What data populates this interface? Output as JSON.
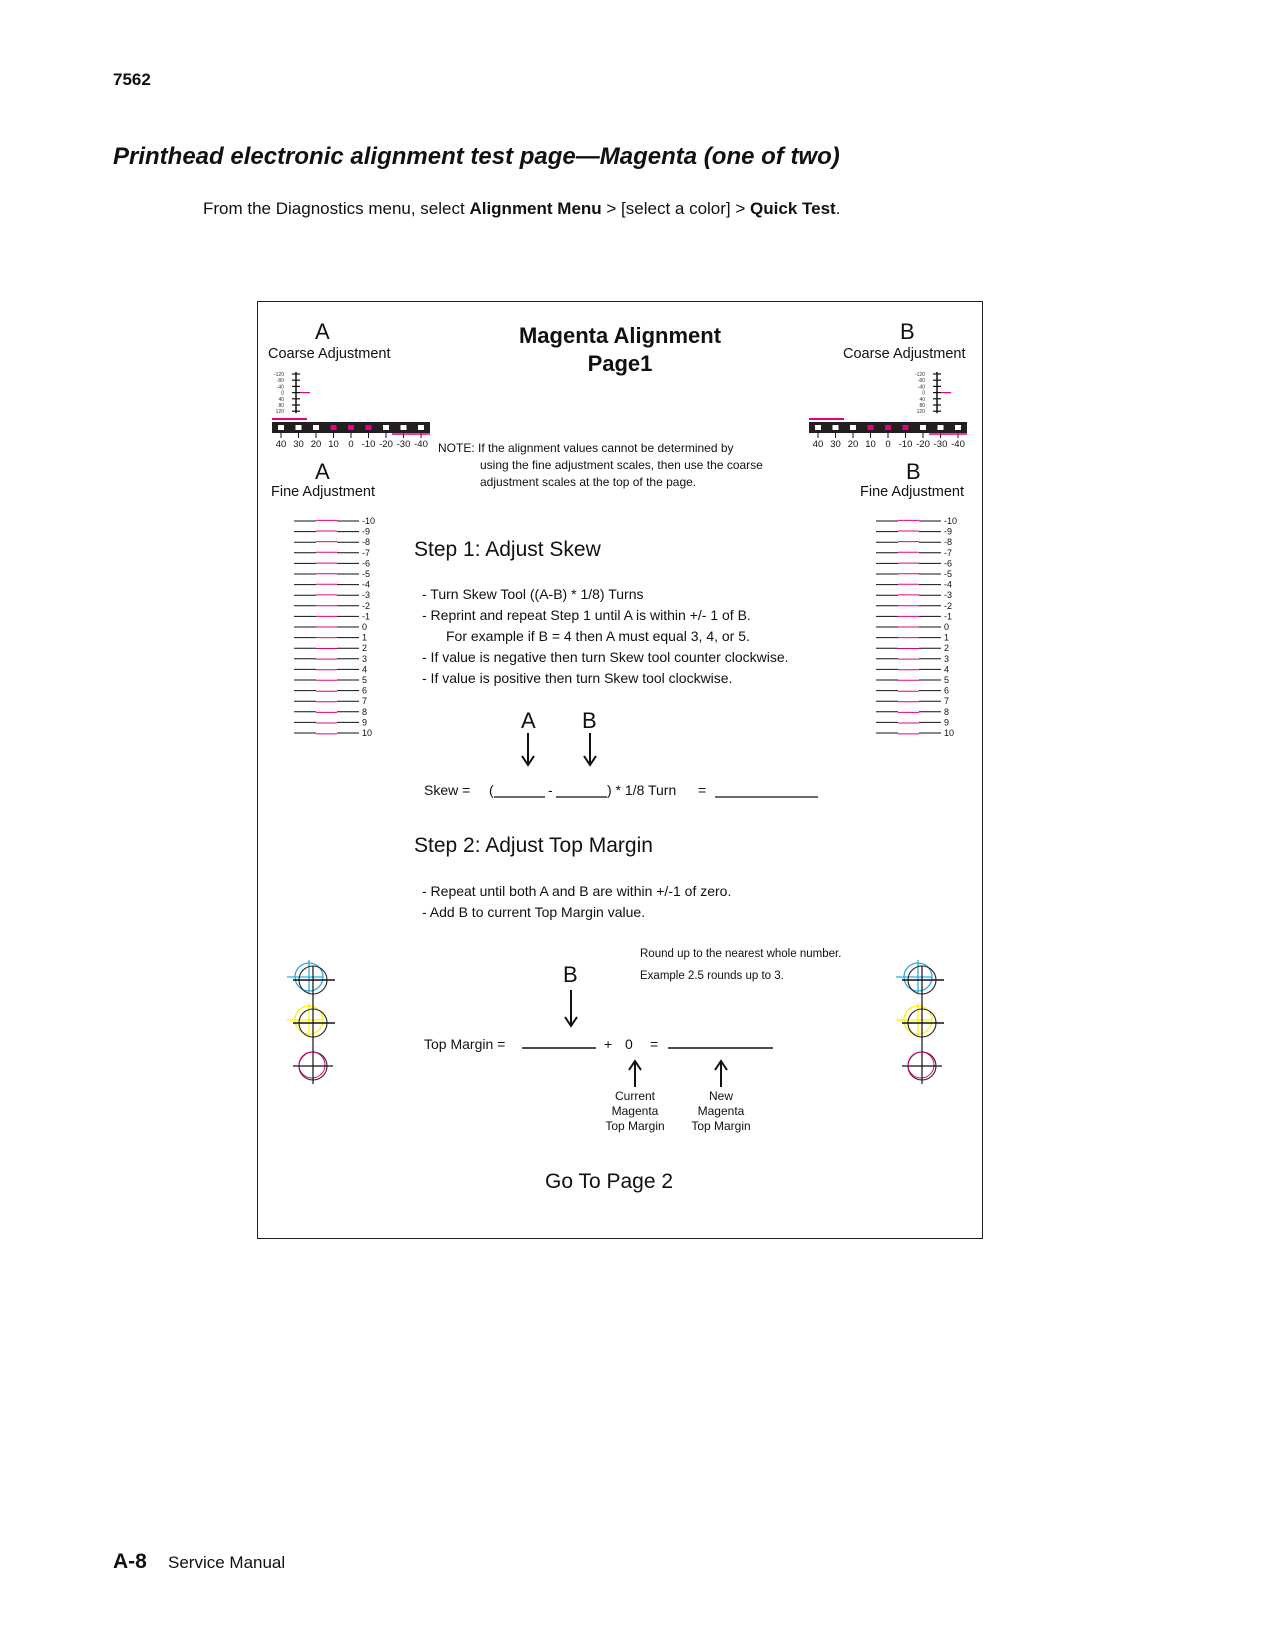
{
  "header": {
    "doc_id": "7562"
  },
  "page_title": "Printhead electronic alignment test page—Magenta (one of two)",
  "instruction": {
    "prefix": "From the Diagnostics menu, select ",
    "bold1": "Alignment Menu",
    "middle": " > [select a color] > ",
    "bold2": "Quick Test",
    "suffix": "."
  },
  "test_page": {
    "title_line1": "Magenta Alignment",
    "title_line2": "Page1",
    "accent_color": "#e6007e",
    "left": {
      "coarse_letter": "A",
      "coarse_label": "Coarse Adjustment",
      "fine_letter": "A",
      "fine_label": "Fine Adjustment"
    },
    "right": {
      "coarse_letter": "B",
      "coarse_label": "Coarse Adjustment",
      "fine_letter": "B",
      "fine_label": "Fine Adjustment"
    },
    "coarse_vertical_ticks": [
      "-120",
      "-80",
      "-40",
      "0",
      "40",
      "80",
      "120"
    ],
    "coarse_bar_ticks": [
      "40",
      "30",
      "20",
      "10",
      "0",
      "-10",
      "-20",
      "-30",
      "-40"
    ],
    "fine_ticks": [
      "-10",
      "-9",
      "-8",
      "-7",
      "-6",
      "-5",
      "-4",
      "-3",
      "-2",
      "-1",
      "0",
      "1",
      "2",
      "3",
      "4",
      "5",
      "6",
      "7",
      "8",
      "9",
      "10"
    ],
    "note_label": "NOTE:",
    "note_lines": [
      "If the alignment values cannot be determined by",
      "using the fine adjustment scales, then use the coarse",
      "adjustment scales at the top of the page."
    ],
    "step1": {
      "heading": "Step 1: Adjust Skew",
      "bullets": [
        "- Turn Skew Tool ((A-B) * 1/8) Turns",
        "- Reprint and repeat Step 1 until A is within +/- 1 of B.",
        "For example if B = 4 then A must equal 3, 4, or 5.",
        "- If value is negative then turn Skew tool counter clockwise.",
        "- If value is positive then turn Skew tool clockwise."
      ],
      "arrow_a": "A",
      "arrow_b": "B",
      "formula_label": "Skew =",
      "formula_open": "(",
      "formula_minus": "-",
      "formula_close": ") * 1/8 Turn",
      "formula_eq": "="
    },
    "step2": {
      "heading": "Step 2: Adjust Top Margin",
      "bullets": [
        "- Repeat until both A and B are within +/-1 of zero.",
        "- Add B to current Top Margin value."
      ],
      "round_note1": "Round up to the nearest whole number.",
      "round_note2": "Example 2.5 rounds up to 3.",
      "arrow_b": "B",
      "formula_label": "Top Margin  =",
      "formula_plus": "+",
      "formula_zero": "0",
      "formula_eq": "=",
      "current_label": [
        "Current",
        "Magenta",
        "Top Margin"
      ],
      "new_label": [
        "New",
        "Magenta",
        "Top Margin"
      ]
    },
    "go_to": "Go To Page 2",
    "registration_colors": [
      "#29abe2",
      "#fff200",
      "#e6007e"
    ]
  },
  "footer": {
    "page_num": "A-8",
    "title": "Service Manual"
  }
}
